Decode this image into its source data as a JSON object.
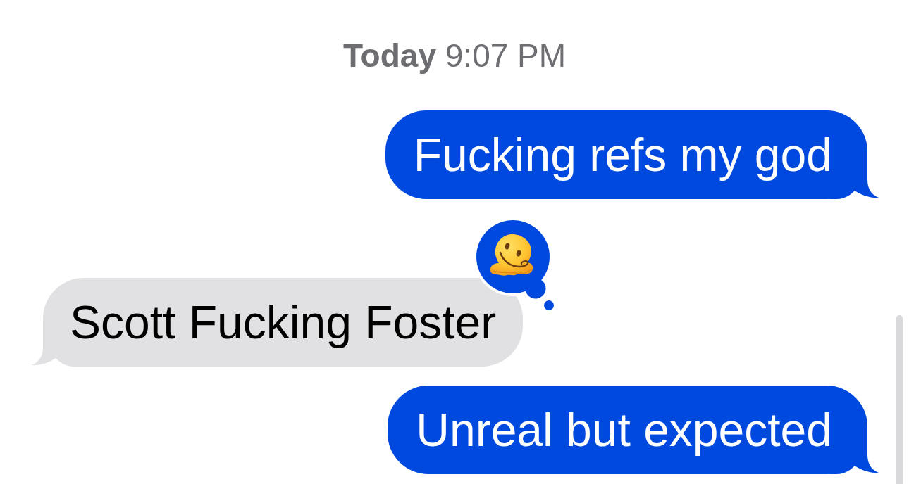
{
  "timestamp": {
    "text": "**Today** 9:07 PM"
  },
  "messages": [
    {
      "kind": "sent",
      "text": "Fucking refs my god",
      "has_reaction": false
    },
    {
      "kind": "received",
      "text": "Scott Fucking Foster",
      "has_reaction": true
    },
    {
      "kind": "sent",
      "text": "Unreal but expected",
      "has_reaction": false
    }
  ]
}
